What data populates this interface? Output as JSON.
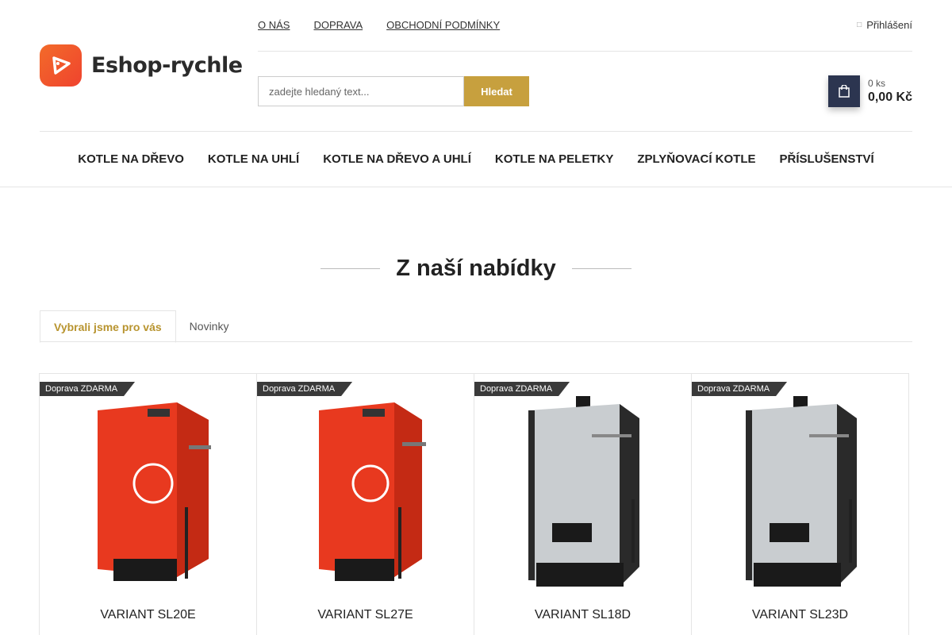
{
  "header": {
    "logo_text": "Eshop-rychle",
    "top_links": [
      "O NÁS",
      "DOPRAVA",
      "OBCHODNÍ PODMÍNKY"
    ],
    "login_label": "Přihlášení",
    "search": {
      "placeholder": "zadejte hledaný text...",
      "button_label": "Hledat"
    },
    "cart": {
      "count": "0 ks",
      "price": "0,00 Kč"
    }
  },
  "nav": {
    "items": [
      "KOTLE NA DŘEVO",
      "KOTLE NA UHLÍ",
      "KOTLE NA DŘEVO A UHLÍ",
      "KOTLE NA PELETKY",
      "ZPLYŇOVACÍ KOTLE",
      "PŘÍSLUŠENSTVÍ"
    ]
  },
  "section": {
    "title": "Z naší nabídky",
    "tabs": [
      "Vybrali jsme pro vás",
      "Novinky"
    ]
  },
  "products": [
    {
      "badge": "Doprava ZDARMA",
      "name": "VARIANT SL20E",
      "color": "red"
    },
    {
      "badge": "Doprava ZDARMA",
      "name": "VARIANT SL27E",
      "color": "red"
    },
    {
      "badge": "Doprava ZDARMA",
      "name": "VARIANT SL18D",
      "color": "grey"
    },
    {
      "badge": "Doprava ZDARMA",
      "name": "VARIANT SL23D",
      "color": "grey"
    }
  ],
  "colors": {
    "accent": "#c7a03e",
    "cart": "#2c3550",
    "logo": "#f0432e",
    "boiler_red": "#e8391f",
    "boiler_grey": "#c9cdd0"
  },
  "icons": {
    "login": "user-icon",
    "cart": "basket-icon",
    "logo": "tag-arrow-icon"
  }
}
